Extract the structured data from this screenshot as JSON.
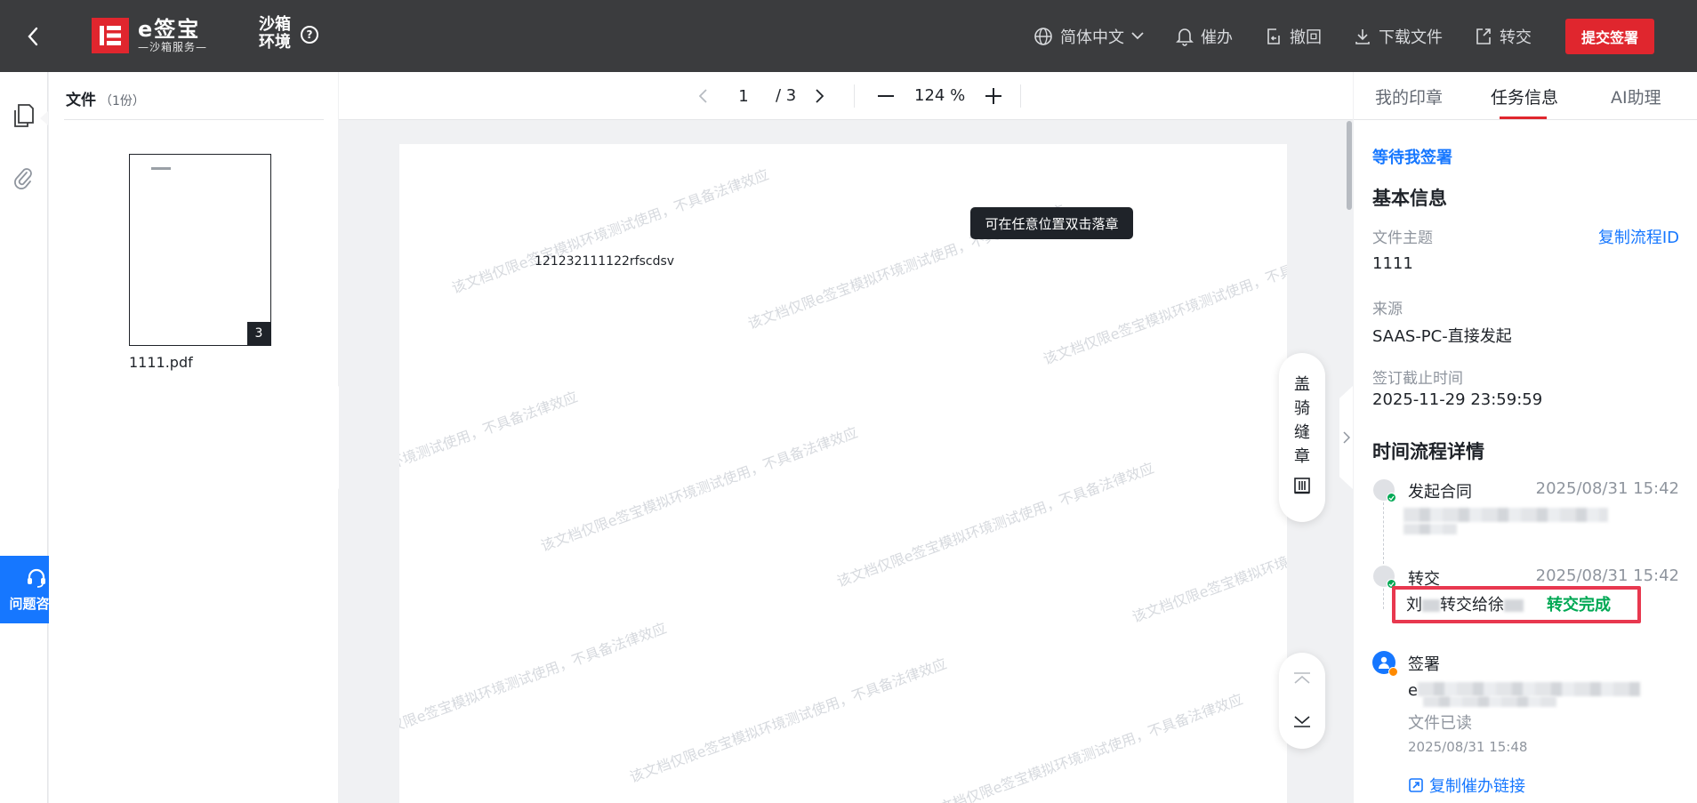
{
  "header": {
    "logo_main": "e签宝",
    "logo_sub": "—沙箱服务—",
    "sandbox_label": "沙箱环境",
    "help_label": "?",
    "actions": {
      "language": "简体中文",
      "remind": "催办",
      "revoke": "撤回",
      "download": "下载文件",
      "transfer": "转交",
      "submit": "提交签署"
    }
  },
  "help_float": {
    "label": "问题咨询"
  },
  "files": {
    "title": "文件",
    "count": "（1份）",
    "items": [
      {
        "name": "1111.pdf",
        "pages": "3"
      }
    ]
  },
  "toolbar": {
    "current_page": "1",
    "total_pages": "/ 3",
    "zoom": "124  %"
  },
  "document": {
    "text": "121232111122rfscdsv",
    "watermark": "该文档仅限e签宝模拟环境测试使用，不具备法律效应",
    "tooltip": "可在任意位置双击落章",
    "seal_chars": [
      "盖",
      "骑",
      "缝",
      "章"
    ]
  },
  "right_panel": {
    "tabs": [
      "我的印章",
      "任务信息",
      "AI助理"
    ],
    "active_tab": 1,
    "status": "等待我签署",
    "basic_title": "基本信息",
    "subject_label": "文件主题",
    "subject_value": "1111",
    "copy_flow_id": "复制流程ID",
    "source_label": "来源",
    "source_value": "SAAS-PC-直接发起",
    "deadline_label": "签订截止时间",
    "deadline_value": "2025-11-29 23:59:59",
    "timeline_title": "时间流程详情",
    "timeline": [
      {
        "title": "发起合同",
        "time": "2025/08/31 15:42"
      },
      {
        "title": "转交",
        "time": "2025/08/31 15:42",
        "detail_a": "刘",
        "detail_b": "转交给徐",
        "result": "转交完成"
      },
      {
        "title": "签署",
        "sub_prefix": "e",
        "sub_note": "文件已读",
        "time": "2025/08/31 15:48"
      }
    ],
    "copy_link": "复制催办链接"
  },
  "colors": {
    "brand_red": "#e0262e",
    "link_blue": "#1677ff",
    "success_green": "#00a854",
    "header_bg": "#3b3c3e"
  }
}
